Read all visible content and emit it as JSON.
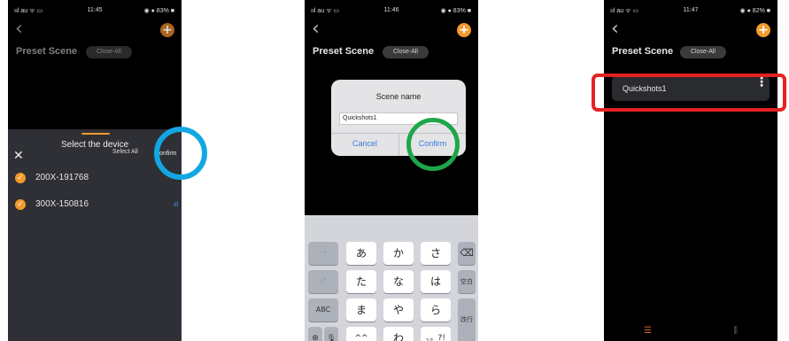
{
  "screen1": {
    "status": {
      "left": "ııl au ᯤ ▭",
      "time": "11:45",
      "right": "◉ ● 83% ■"
    },
    "back_icon": "‹",
    "add_icon": "+",
    "title": "Preset Scene",
    "close_all": "Close-All",
    "sheet": {
      "close_icon": "✕",
      "title": "Select the device",
      "select_all": "Select All",
      "confirm": "Confirm",
      "check_icon": "✓",
      "devices": [
        {
          "name": "200X-191768",
          "signal": ""
        },
        {
          "name": "300X-150816",
          "signal": "ıll"
        }
      ]
    },
    "highlight_color": "#12a7e3"
  },
  "screen2": {
    "status": {
      "left": "ııl au ᯤ ▭",
      "time": "11:46",
      "right": "◉ ● 83% ■"
    },
    "back_icon": "‹",
    "add_icon": "+",
    "title": "Preset Scene",
    "close_all": "Close-All",
    "dialog": {
      "title": "Scene name",
      "input_value": "Quickshots1",
      "cancel": "Cancel",
      "confirm": "Confirm"
    },
    "keyboard": {
      "row1": [
        "→",
        "あ",
        "か",
        "さ",
        "⌫"
      ],
      "row2": [
        "↺",
        "た",
        "な",
        "は",
        "空白"
      ],
      "row3": [
        "ABC",
        "ま",
        "や",
        "ら"
      ],
      "row4": [
        "⊕",
        "🎙",
        "^^",
        "わ",
        "、。?!"
      ],
      "return": "改行"
    },
    "highlight_color": "#1fa64a"
  },
  "screen3": {
    "status": {
      "left": "ııl au ᯤ ▭",
      "time": "11:47",
      "right": "◉ ● 82% ■"
    },
    "back_icon": "‹",
    "add_icon": "+",
    "title": "Preset Scene",
    "close_all": "Close-All",
    "scene": {
      "name": "Quickshots1",
      "menu_icon": "⋮"
    },
    "tabs": {
      "list_icon": "☰",
      "mixer_icon": "⫼"
    },
    "highlight_color": "#e42222"
  },
  "accent_color": "#f39a2c"
}
